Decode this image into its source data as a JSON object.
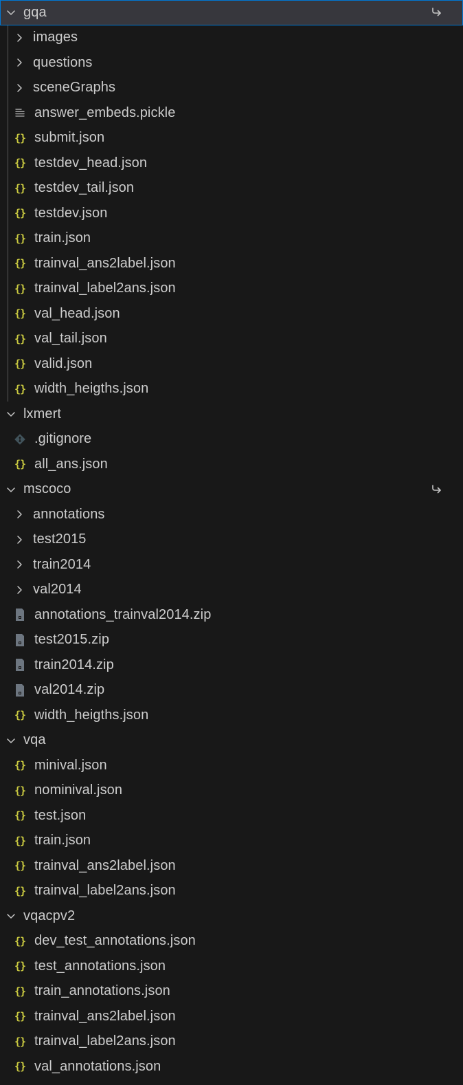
{
  "explorer": {
    "items": [
      {
        "type": "folder",
        "label": "gqa",
        "level": 0,
        "expanded": true,
        "selected": true,
        "trailing": "follow-arrow-icon"
      },
      {
        "type": "folder",
        "label": "images",
        "level": 1,
        "expanded": false
      },
      {
        "type": "folder",
        "label": "questions",
        "level": 1,
        "expanded": false
      },
      {
        "type": "folder",
        "label": "sceneGraphs",
        "level": 1,
        "expanded": false
      },
      {
        "type": "file",
        "icon": "text-file-icon",
        "label": "answer_embeds.pickle",
        "level": 1
      },
      {
        "type": "file",
        "icon": "json-icon",
        "label": "submit.json",
        "level": 1
      },
      {
        "type": "file",
        "icon": "json-icon",
        "label": "testdev_head.json",
        "level": 1
      },
      {
        "type": "file",
        "icon": "json-icon",
        "label": "testdev_tail.json",
        "level": 1
      },
      {
        "type": "file",
        "icon": "json-icon",
        "label": "testdev.json",
        "level": 1
      },
      {
        "type": "file",
        "icon": "json-icon",
        "label": "train.json",
        "level": 1
      },
      {
        "type": "file",
        "icon": "json-icon",
        "label": "trainval_ans2label.json",
        "level": 1
      },
      {
        "type": "file",
        "icon": "json-icon",
        "label": "trainval_label2ans.json",
        "level": 1
      },
      {
        "type": "file",
        "icon": "json-icon",
        "label": "val_head.json",
        "level": 1
      },
      {
        "type": "file",
        "icon": "json-icon",
        "label": "val_tail.json",
        "level": 1
      },
      {
        "type": "file",
        "icon": "json-icon",
        "label": "valid.json",
        "level": 1
      },
      {
        "type": "file",
        "icon": "json-icon",
        "label": "width_heigths.json",
        "level": 1
      },
      {
        "type": "folder",
        "label": "lxmert",
        "level": 0,
        "expanded": true
      },
      {
        "type": "file",
        "icon": "git-icon",
        "label": ".gitignore",
        "level": 1
      },
      {
        "type": "file",
        "icon": "json-icon",
        "label": "all_ans.json",
        "level": 1
      },
      {
        "type": "folder",
        "label": "mscoco",
        "level": 0,
        "expanded": true,
        "trailing": "follow-arrow-icon"
      },
      {
        "type": "folder",
        "label": "annotations",
        "level": 1,
        "expanded": false
      },
      {
        "type": "folder",
        "label": "test2015",
        "level": 1,
        "expanded": false
      },
      {
        "type": "folder",
        "label": "train2014",
        "level": 1,
        "expanded": false
      },
      {
        "type": "folder",
        "label": "val2014",
        "level": 1,
        "expanded": false
      },
      {
        "type": "file",
        "icon": "zip-icon",
        "label": "annotations_trainval2014.zip",
        "level": 1
      },
      {
        "type": "file",
        "icon": "zip-icon",
        "label": "test2015.zip",
        "level": 1
      },
      {
        "type": "file",
        "icon": "zip-icon",
        "label": "train2014.zip",
        "level": 1
      },
      {
        "type": "file",
        "icon": "zip-icon",
        "label": "val2014.zip",
        "level": 1
      },
      {
        "type": "file",
        "icon": "json-icon",
        "label": "width_heigths.json",
        "level": 1
      },
      {
        "type": "folder",
        "label": "vqa",
        "level": 0,
        "expanded": true
      },
      {
        "type": "file",
        "icon": "json-icon",
        "label": "minival.json",
        "level": 1
      },
      {
        "type": "file",
        "icon": "json-icon",
        "label": "nominival.json",
        "level": 1
      },
      {
        "type": "file",
        "icon": "json-icon",
        "label": "test.json",
        "level": 1
      },
      {
        "type": "file",
        "icon": "json-icon",
        "label": "train.json",
        "level": 1
      },
      {
        "type": "file",
        "icon": "json-icon",
        "label": "trainval_ans2label.json",
        "level": 1
      },
      {
        "type": "file",
        "icon": "json-icon",
        "label": "trainval_label2ans.json",
        "level": 1
      },
      {
        "type": "folder",
        "label": "vqacpv2",
        "level": 0,
        "expanded": true
      },
      {
        "type": "file",
        "icon": "json-icon",
        "label": "dev_test_annotations.json",
        "level": 1
      },
      {
        "type": "file",
        "icon": "json-icon",
        "label": "test_annotations.json",
        "level": 1
      },
      {
        "type": "file",
        "icon": "json-icon",
        "label": "train_annotations.json",
        "level": 1
      },
      {
        "type": "file",
        "icon": "json-icon",
        "label": "trainval_ans2label.json",
        "level": 1
      },
      {
        "type": "file",
        "icon": "json-icon",
        "label": "trainval_label2ans.json",
        "level": 1
      },
      {
        "type": "file",
        "icon": "json-icon",
        "label": "val_annotations.json",
        "level": 1
      }
    ]
  },
  "colors": {
    "background": "#181818",
    "selected_background": "#37373d",
    "focus_border": "#0078d4",
    "text": "#cccccc",
    "json_icon": "#cbcb41",
    "icon_gray": "#8a8f98"
  }
}
